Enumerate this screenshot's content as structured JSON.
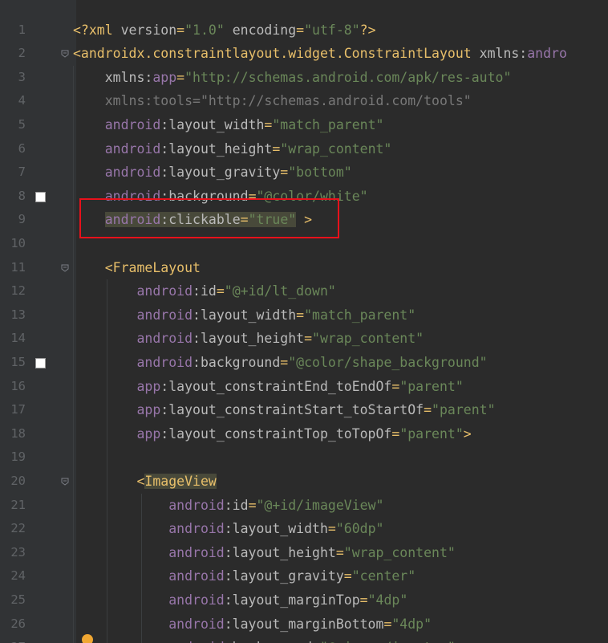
{
  "editor": {
    "accent_highlight_color": "#e8111b",
    "lines": [
      {
        "n": "1",
        "fold": false,
        "swatch": false,
        "tokens": [
          [
            "t-tag",
            "<?xml "
          ],
          [
            "t-attr",
            "version"
          ],
          [
            "t-tag",
            "="
          ],
          [
            "t-str",
            "\"1.0\""
          ],
          [
            "t-attr",
            " encoding"
          ],
          [
            "t-tag",
            "="
          ],
          [
            "t-str",
            "\"utf-8\""
          ],
          [
            "t-tag",
            "?>"
          ]
        ]
      },
      {
        "n": "2",
        "fold": true,
        "swatch": false,
        "tokens": [
          [
            "t-tag",
            "<androidx.constraintlayout.widget.ConstraintLayout "
          ],
          [
            "t-attr",
            "xmlns:"
          ],
          [
            "t-ns",
            "andro"
          ]
        ]
      },
      {
        "n": "3",
        "fold": false,
        "swatch": false,
        "tokens": [
          [
            "t-attr",
            "    xmlns:"
          ],
          [
            "t-ns",
            "app"
          ],
          [
            "t-tag",
            "="
          ],
          [
            "t-str",
            "\"http://schemas.android.com/apk/res-auto\""
          ]
        ]
      },
      {
        "n": "4",
        "fold": false,
        "swatch": false,
        "tokens": [
          [
            "t-dim",
            "    xmlns:tools=\"http://schemas.android.com/tools\""
          ]
        ]
      },
      {
        "n": "5",
        "fold": false,
        "swatch": false,
        "tokens": [
          [
            "t-ns",
            "    android"
          ],
          [
            "t-attr",
            ":layout_width"
          ],
          [
            "t-tag",
            "="
          ],
          [
            "t-str",
            "\"match_parent\""
          ]
        ]
      },
      {
        "n": "6",
        "fold": false,
        "swatch": false,
        "tokens": [
          [
            "t-ns",
            "    android"
          ],
          [
            "t-attr",
            ":layout_height"
          ],
          [
            "t-tag",
            "="
          ],
          [
            "t-str",
            "\"wrap_content\""
          ]
        ]
      },
      {
        "n": "7",
        "fold": false,
        "swatch": false,
        "tokens": [
          [
            "t-ns",
            "    android"
          ],
          [
            "t-attr",
            ":layout_gravity"
          ],
          [
            "t-tag",
            "="
          ],
          [
            "t-str",
            "\"bottom\""
          ]
        ]
      },
      {
        "n": "8",
        "fold": false,
        "swatch": true,
        "tokens": [
          [
            "t-ns",
            "    android"
          ],
          [
            "t-attr",
            ":background"
          ],
          [
            "t-tag",
            "="
          ],
          [
            "t-str",
            "\"@color/white\""
          ]
        ]
      },
      {
        "n": "9",
        "fold": false,
        "swatch": false,
        "tokens": [
          [
            "t-ns hl",
            "    android"
          ],
          [
            "t-attr hl",
            ":clickable"
          ],
          [
            "t-tag hl",
            "="
          ],
          [
            "t-str hl",
            "\"true\""
          ],
          [
            "t-tag",
            " >"
          ]
        ]
      },
      {
        "n": "10",
        "fold": false,
        "swatch": false,
        "tokens": []
      },
      {
        "n": "11",
        "fold": true,
        "swatch": false,
        "tokens": [
          [
            "t-tag",
            "    <FrameLayout"
          ]
        ]
      },
      {
        "n": "12",
        "fold": false,
        "swatch": false,
        "tokens": [
          [
            "t-ns",
            "        android"
          ],
          [
            "t-attr",
            ":id"
          ],
          [
            "t-tag",
            "="
          ],
          [
            "t-str",
            "\"@+id/lt_down\""
          ]
        ]
      },
      {
        "n": "13",
        "fold": false,
        "swatch": false,
        "tokens": [
          [
            "t-ns",
            "        android"
          ],
          [
            "t-attr",
            ":layout_width"
          ],
          [
            "t-tag",
            "="
          ],
          [
            "t-str",
            "\"match_parent\""
          ]
        ]
      },
      {
        "n": "14",
        "fold": false,
        "swatch": false,
        "tokens": [
          [
            "t-ns",
            "        android"
          ],
          [
            "t-attr",
            ":layout_height"
          ],
          [
            "t-tag",
            "="
          ],
          [
            "t-str",
            "\"wrap_content\""
          ]
        ]
      },
      {
        "n": "15",
        "fold": false,
        "swatch": true,
        "tokens": [
          [
            "t-ns",
            "        android"
          ],
          [
            "t-attr",
            ":background"
          ],
          [
            "t-tag",
            "="
          ],
          [
            "t-str",
            "\"@color/shape_background\""
          ]
        ]
      },
      {
        "n": "16",
        "fold": false,
        "swatch": false,
        "tokens": [
          [
            "t-ns",
            "        app"
          ],
          [
            "t-attr",
            ":layout_constraintEnd_toEndOf"
          ],
          [
            "t-tag",
            "="
          ],
          [
            "t-str",
            "\"parent\""
          ]
        ]
      },
      {
        "n": "17",
        "fold": false,
        "swatch": false,
        "tokens": [
          [
            "t-ns",
            "        app"
          ],
          [
            "t-attr",
            ":layout_constraintStart_toStartOf"
          ],
          [
            "t-tag",
            "="
          ],
          [
            "t-str",
            "\"parent\""
          ]
        ]
      },
      {
        "n": "18",
        "fold": false,
        "swatch": false,
        "tokens": [
          [
            "t-ns",
            "        app"
          ],
          [
            "t-attr",
            ":layout_constraintTop_toTopOf"
          ],
          [
            "t-tag",
            "="
          ],
          [
            "t-str",
            "\"parent\""
          ],
          [
            "t-tag",
            ">"
          ]
        ]
      },
      {
        "n": "19",
        "fold": false,
        "swatch": false,
        "tokens": []
      },
      {
        "n": "20",
        "fold": true,
        "swatch": false,
        "tokens": [
          [
            "t-tag",
            "        <"
          ],
          [
            "t-tag hl",
            "ImageView"
          ]
        ]
      },
      {
        "n": "21",
        "fold": false,
        "swatch": false,
        "tokens": [
          [
            "t-ns",
            "            android"
          ],
          [
            "t-attr",
            ":id"
          ],
          [
            "t-tag",
            "="
          ],
          [
            "t-str",
            "\"@+id/imageView\""
          ]
        ]
      },
      {
        "n": "22",
        "fold": false,
        "swatch": false,
        "tokens": [
          [
            "t-ns",
            "            android"
          ],
          [
            "t-attr",
            ":layout_width"
          ],
          [
            "t-tag",
            "="
          ],
          [
            "t-str",
            "\"60dp\""
          ]
        ]
      },
      {
        "n": "23",
        "fold": false,
        "swatch": false,
        "tokens": [
          [
            "t-ns",
            "            android"
          ],
          [
            "t-attr",
            ":layout_height"
          ],
          [
            "t-tag",
            "="
          ],
          [
            "t-str",
            "\"wrap_content\""
          ]
        ]
      },
      {
        "n": "24",
        "fold": false,
        "swatch": false,
        "tokens": [
          [
            "t-ns",
            "            android"
          ],
          [
            "t-attr",
            ":layout_gravity"
          ],
          [
            "t-tag",
            "="
          ],
          [
            "t-str",
            "\"center\""
          ]
        ]
      },
      {
        "n": "25",
        "fold": false,
        "swatch": false,
        "tokens": [
          [
            "t-ns",
            "            android"
          ],
          [
            "t-attr",
            ":layout_marginTop"
          ],
          [
            "t-tag",
            "="
          ],
          [
            "t-str",
            "\"4dp\""
          ]
        ]
      },
      {
        "n": "26",
        "fold": false,
        "swatch": false,
        "tokens": [
          [
            "t-ns",
            "            android"
          ],
          [
            "t-attr",
            ":layout_marginBottom"
          ],
          [
            "t-tag",
            "="
          ],
          [
            "t-str",
            "\"4dp\""
          ]
        ]
      },
      {
        "n": "27",
        "fold": false,
        "swatch": false,
        "tokens": [
          [
            "t-ns",
            "            android"
          ],
          [
            "t-attr",
            ":background"
          ],
          [
            "t-tag",
            "="
          ],
          [
            "t-str",
            "\"@mipmap/ic_stop\""
          ]
        ]
      }
    ]
  }
}
